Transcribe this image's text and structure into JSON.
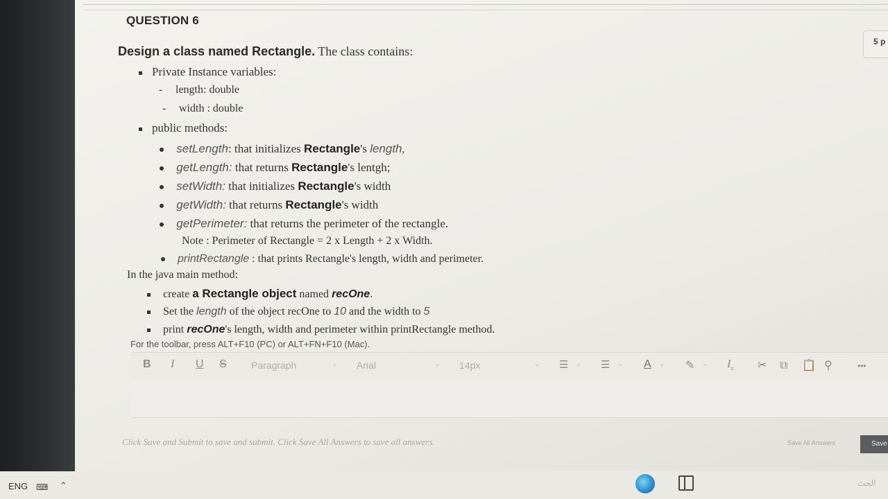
{
  "question": {
    "title": "QUESTION 6",
    "points": "5 p"
  },
  "content": {
    "intro": {
      "bold": "Design a class named Rectangle.",
      "rest": " The class contains:"
    },
    "private_heading": "Private Instance variables:",
    "private_vars": [
      "length: double",
      "width : double"
    ],
    "public_heading": "public methods:",
    "methods": [
      {
        "name": "setLength",
        "pre": ": that initializes ",
        "cls": "Rectangle",
        "post": "'s ",
        "tail": "length,",
        "tail_italic": true
      },
      {
        "name": "getLength:",
        "pre": " that returns ",
        "cls": "Rectangle",
        "post": "'s lentgh;",
        "tail": "",
        "tail_italic": false
      },
      {
        "name": "setWidth:",
        "pre": " that initializes ",
        "cls": "Rectangle",
        "post": "'s  width",
        "tail": "",
        "tail_italic": false
      },
      {
        "name": "getWidth:",
        "pre": " that returns ",
        "cls": "Rectangle",
        "post": "'s width",
        "tail": "",
        "tail_italic": false
      },
      {
        "name": "getPerimeter:",
        "pre": " that returns the perimeter of the rectangle.",
        "cls": "",
        "post": "",
        "tail": "",
        "tail_italic": false
      }
    ],
    "note": "Note : Perimeter of Rectangle = 2 x Length + 2 x Width.",
    "print_method": {
      "name": "printRectangle",
      "text": " : that prints Rectangle's length, width and perimeter."
    },
    "main_heading": "In the java main method:",
    "main_items": [
      {
        "a": "create ",
        "b": "a Rectangle object",
        "c": " named ",
        "d": "recOne",
        "e": "."
      },
      {
        "a": "Set the ",
        "b": "length",
        "c": " of the object recOne to ",
        "d": "10",
        "e": " and  the width to ",
        "f": "5"
      },
      {
        "a": "print ",
        "b": "recOne",
        "c": "'s length, width and perimeter within printRectangle method."
      }
    ]
  },
  "editor": {
    "toolbar_hint": "For the toolbar, press ALT+F10 (PC) or ALT+FN+F10 (Mac).",
    "bold": "B",
    "italic": "I",
    "underline": "U",
    "strike": "S",
    "paragraph": "Paragraph",
    "font": "Arial",
    "size": "14px",
    "more": "•••"
  },
  "footer": {
    "submit_hint": "Click Save and Submit to save and submit. Click Save All Answers to save all answers.",
    "save_all": "Save All Answers",
    "save": "Save"
  },
  "taskbar": {
    "lang": "ENG",
    "arabic": "الحث"
  },
  "colors": {
    "accent_dark": "#2a2a2a",
    "muted": "#a9a7a2",
    "save_button_bg": "#5a5c5e"
  }
}
